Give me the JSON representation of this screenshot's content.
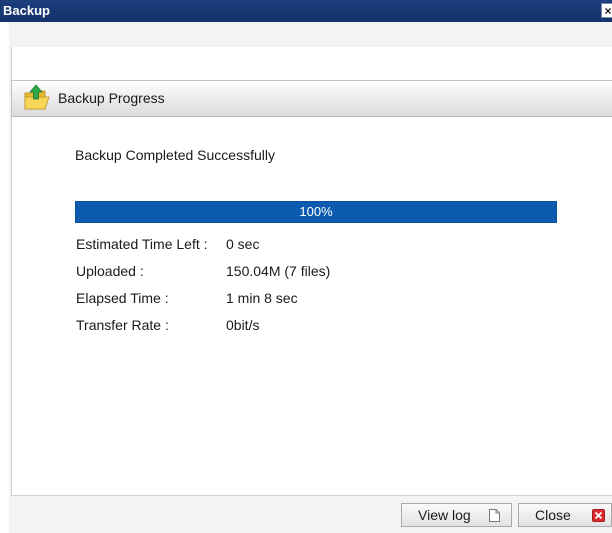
{
  "window": {
    "title": "Backup",
    "close_glyph": "×"
  },
  "section": {
    "title": "Backup Progress",
    "icon": "folder-upload-icon"
  },
  "status": {
    "message": "Backup Completed Successfully"
  },
  "progress": {
    "percent": 100,
    "label": "100%",
    "fill_color": "#0d5bb0"
  },
  "stats": [
    {
      "label": "Estimated Time Left :",
      "value": "0 sec"
    },
    {
      "label": "Uploaded :",
      "value": "150.04M (7 files)"
    },
    {
      "label": "Elapsed Time :",
      "value": "1 min 8 sec"
    },
    {
      "label": "Transfer Rate :",
      "value": "0bit/s"
    }
  ],
  "buttons": {
    "view_log": {
      "label": "View log",
      "icon": "document-icon"
    },
    "close": {
      "label": "Close",
      "icon": "red-x-icon",
      "icon_color": "#d9292e"
    }
  },
  "colors": {
    "titlebar": "#1d3f7e",
    "accent": "#0d5bb0"
  }
}
